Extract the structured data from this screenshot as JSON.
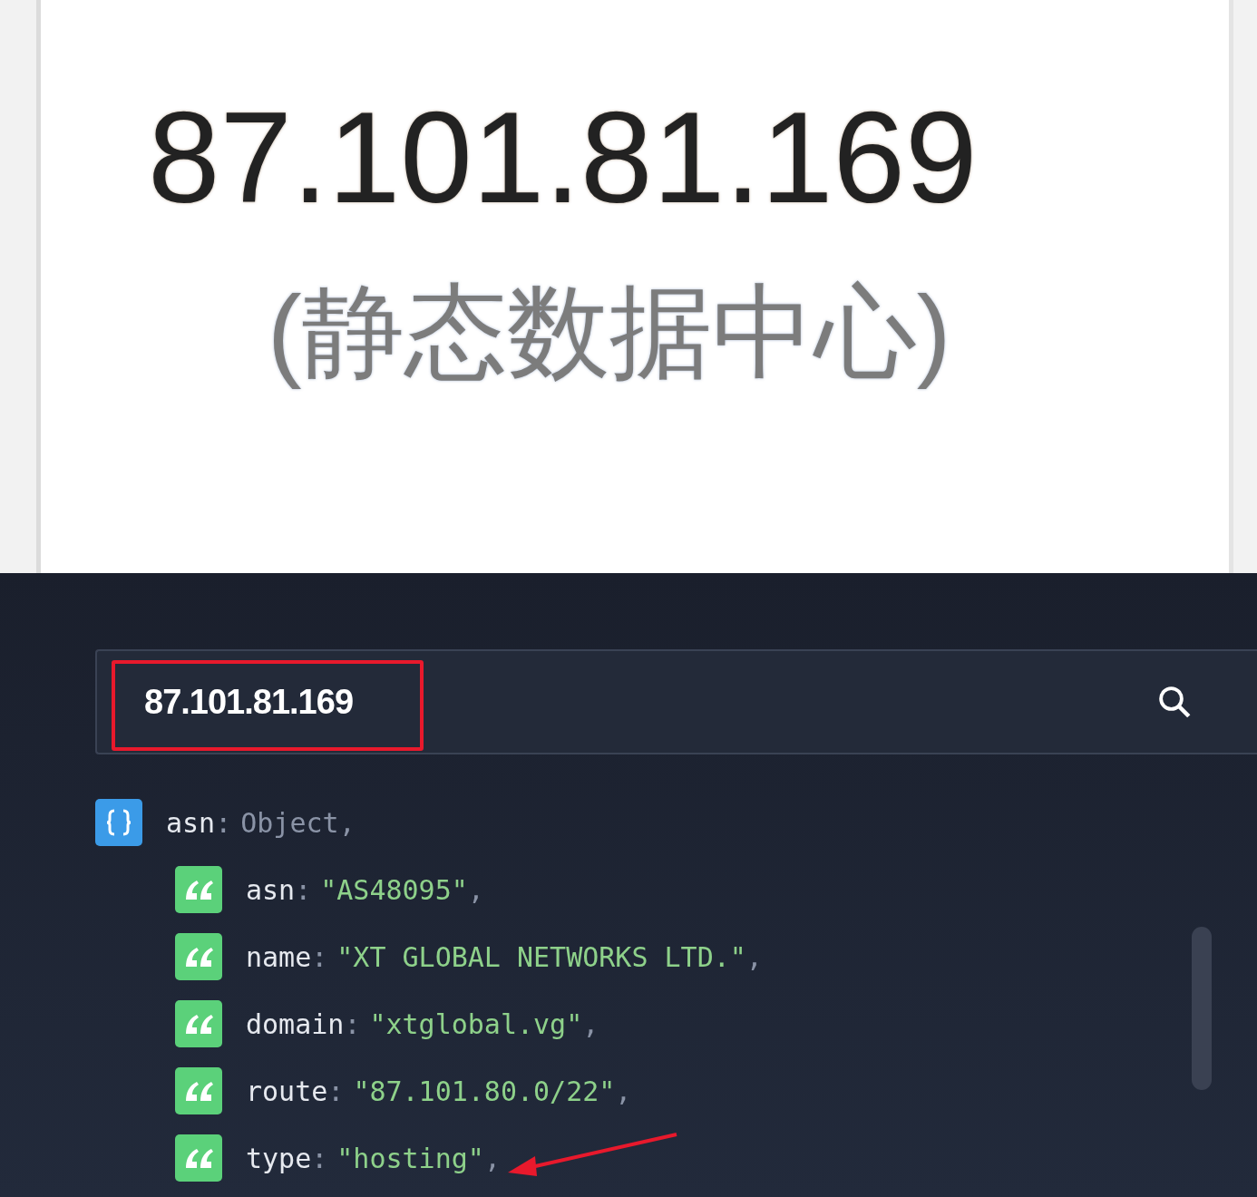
{
  "top": {
    "ip": "87.101.81.169",
    "label": "(静态数据中心)"
  },
  "search": {
    "value": "87.101.81.169",
    "highlighted": true
  },
  "tree": [
    {
      "kind": "object",
      "key": "asn",
      "colon": ":",
      "value": "Object",
      "trail": ",",
      "children": [
        {
          "kind": "string",
          "key": "asn",
          "colon": ":",
          "value": "\"AS48095\"",
          "trail": ","
        },
        {
          "kind": "string",
          "key": "name",
          "colon": ":",
          "value": "\"XT GLOBAL NETWORKS LTD.\"",
          "trail": ","
        },
        {
          "kind": "string",
          "key": "domain",
          "colon": ":",
          "value": "\"xtglobal.vg\"",
          "trail": ","
        },
        {
          "kind": "string",
          "key": "route",
          "colon": ":",
          "value": "\"87.101.80.0/22\"",
          "trail": ","
        },
        {
          "kind": "string",
          "key": "type",
          "colon": ":",
          "value": "\"hosting\"",
          "trail": ",",
          "arrow": true
        }
      ]
    }
  ]
}
